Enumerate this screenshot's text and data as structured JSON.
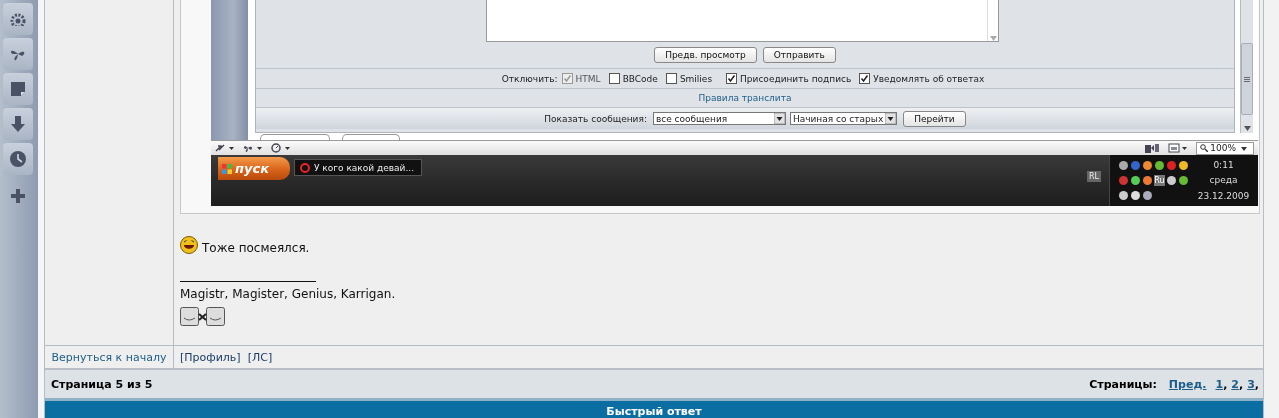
{
  "screenshot": {
    "form": {
      "buttons": [
        "Предв. просмотр",
        "Отправить"
      ],
      "disable_label": "Отключить:",
      "options": [
        {
          "label": "HTML",
          "checked": true,
          "disabled": true
        },
        {
          "label": "BBCode",
          "checked": false,
          "disabled": false
        },
        {
          "label": "Smilies",
          "checked": false,
          "disabled": false
        },
        {
          "label": "Присоединить подпись",
          "checked": true,
          "disabled": false
        },
        {
          "label": "Уведомлять об ответах",
          "checked": true,
          "disabled": false
        }
      ],
      "translit_link": "Правила транслита",
      "show_label": "Показать сообщения:",
      "show_select": "все сообщения",
      "order_select": "Начиная со старых",
      "go_button": "Перейти"
    },
    "browser_status": {
      "zoom": "100%"
    },
    "taskbar": {
      "start": "пуск",
      "tasks": [
        "У кого какой девай..."
      ],
      "lang": "RL",
      "tray_lang": "Ru",
      "time": "0:11",
      "day": "среда",
      "date": "23.12.2009"
    }
  },
  "post": {
    "message": "Тоже посмеялся.",
    "signature": "Magistr, Magister, Genius, Karrigan."
  },
  "post_footer": {
    "back_link": "Вернуться к началу",
    "links": [
      "[Профиль]",
      "[ЛС]"
    ]
  },
  "pagination": {
    "page_info": "Страница 5 из 5",
    "label": "Страницы:",
    "separator": ",",
    "links": [
      "Пред.",
      "1",
      "2",
      "3"
    ]
  },
  "quick_reply": {
    "title": "Быстрый ответ"
  }
}
